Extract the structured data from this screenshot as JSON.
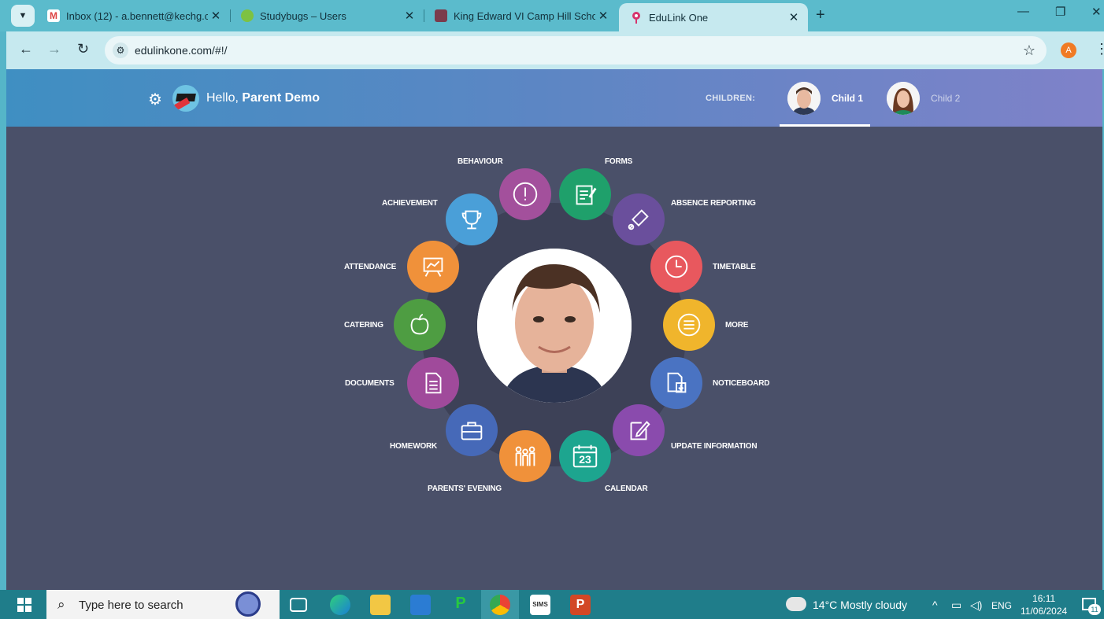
{
  "browser": {
    "tabs": [
      {
        "title": "Inbox (12) - a.bennett@kechg.c",
        "close": "✕"
      },
      {
        "title": "Studybugs – Users",
        "close": "✕"
      },
      {
        "title": "King Edward VI Camp Hill Scho",
        "close": "✕"
      },
      {
        "title": "EduLink One",
        "close": "✕"
      }
    ],
    "new_tab": "+",
    "url": "edulinkone.com/#!/",
    "profile_initial": "A"
  },
  "header": {
    "greeting_prefix": "Hello,",
    "greeting_name": "Parent Demo",
    "children_label": "CHILDREN:",
    "children": [
      {
        "name": "Child 1"
      },
      {
        "name": "Child 2"
      }
    ]
  },
  "menu": {
    "behaviour": "BEHAVIOUR",
    "forms": "FORMS",
    "achievement": "ACHIEVEMENT",
    "absence": "ABSENCE REPORTING",
    "attendance": "ATTENDANCE",
    "timetable": "TIMETABLE",
    "catering": "CATERING",
    "more": "MORE",
    "documents": "DOCUMENTS",
    "noticeboard": "NOTICEBOARD",
    "homework": "HOMEWORK",
    "update": "UPDATE INFORMATION",
    "parents_evening": "PARENTS' EVENING",
    "calendar": "CALENDAR",
    "calendar_day": "23"
  },
  "colors": {
    "behaviour": "#a3509c",
    "forms": "#1fa06b",
    "achievement": "#4a9fd8",
    "absence": "#6a4f9c",
    "attendance": "#f0913a",
    "timetable": "#e8585e",
    "catering": "#4e9d42",
    "more": "#f0b52c",
    "documents": "#a04a9b",
    "noticeboard": "#4a73c2",
    "homework": "#4669b8",
    "update": "#8a4bad",
    "parents_evening": "#f0913a",
    "calendar": "#1da58f"
  },
  "taskbar": {
    "search_placeholder": "Type here to search",
    "weather": "14°C  Mostly cloudy",
    "lang": "ENG",
    "time": "16:11",
    "date": "11/06/2024",
    "notifications": "11",
    "sims": "SIMS"
  }
}
